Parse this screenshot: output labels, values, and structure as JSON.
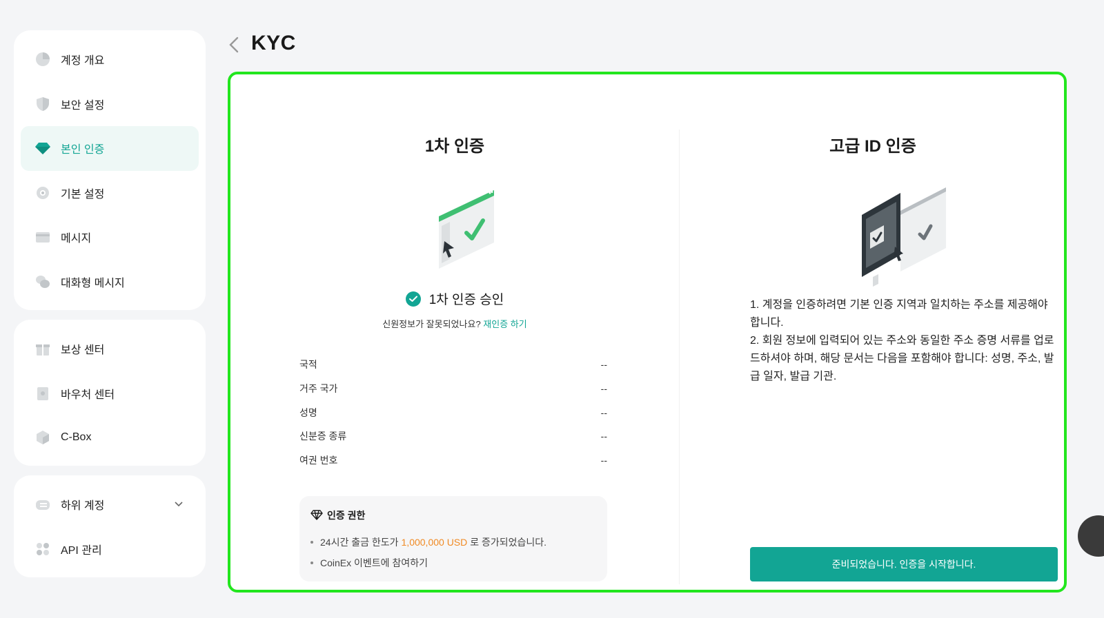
{
  "sidebar": {
    "group1": [
      {
        "label": "계정 개요",
        "icon": "pie-chart-icon"
      },
      {
        "label": "보안 설정",
        "icon": "shield-icon"
      },
      {
        "label": "본인 인증",
        "icon": "diamond-icon",
        "active": true
      },
      {
        "label": "기본 설정",
        "icon": "gear-icon"
      },
      {
        "label": "메시지",
        "icon": "card-icon"
      },
      {
        "label": "대화형 메시지",
        "icon": "chat-icon"
      }
    ],
    "group2": [
      {
        "label": "보상 센터",
        "icon": "gift-icon"
      },
      {
        "label": "바우처 센터",
        "icon": "voucher-icon"
      },
      {
        "label": "C-Box",
        "icon": "box-icon"
      }
    ],
    "group3": [
      {
        "label": "하위 계정",
        "icon": "sub-account-icon",
        "chevron": "chevron-down-icon"
      },
      {
        "label": "API 관리",
        "icon": "api-icon"
      }
    ]
  },
  "header": {
    "title": "KYC",
    "back_icon": "chevron-left-icon"
  },
  "primary": {
    "title": "1차 인증",
    "status": "1차 인증 승인",
    "reverify_prompt": "신원정보가 잘못되었나요?",
    "reverify_link": "재인증 하기",
    "rows": [
      {
        "label": "국적",
        "value": "--"
      },
      {
        "label": "거주 국가",
        "value": "--"
      },
      {
        "label": "성명",
        "value": "--"
      },
      {
        "label": "신분증 종류",
        "value": "--"
      },
      {
        "label": "여권 번호",
        "value": "--"
      }
    ],
    "permissions": {
      "title": "인증 권한",
      "item1_prefix": "24시간 출금 한도가",
      "item1_amount": "1,000,000 USD",
      "item1_suffix": "로 증가되었습니다.",
      "item2": "CoinEx 이벤트에 참여하기"
    }
  },
  "advanced": {
    "title": "고급 ID 인증",
    "req1": "1. 계정을 인증하려면 기본 인증 지역과 일치하는 주소를 제공해야 합니다.",
    "req2": "2. 회원 정보에 입력되어 있는 주소와 동일한 주소 증명 서류를 업로드하셔야 하며, 해당 문서는 다음을 포함해야 합니다: 성명, 주소, 발급 일자, 발급 기관.",
    "button": "준비되었습니다. 인증을 시작합니다."
  },
  "colors": {
    "accent": "#12a594",
    "highlight": "#f08a24",
    "frame": "#22e61e"
  }
}
